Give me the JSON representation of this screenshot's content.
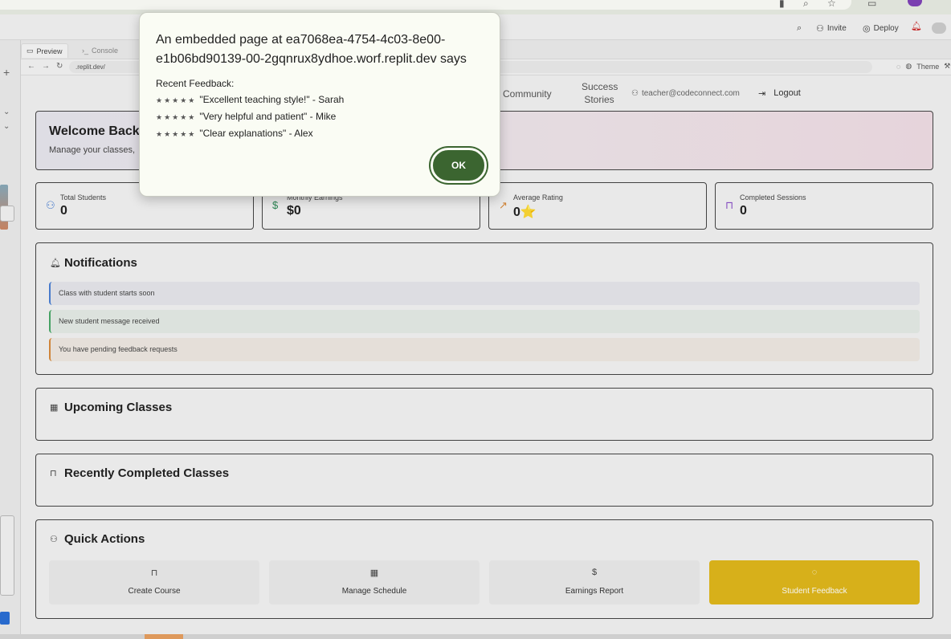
{
  "replit": {
    "header": {
      "invite_label": "Invite",
      "deploy_label": "Deploy"
    },
    "pane_tabs": [
      "Preview",
      "Console"
    ],
    "url": ".replit.dev/",
    "theme_label": "Theme"
  },
  "app": {
    "nav": {
      "community": "Community",
      "success_stories_line1": "Success",
      "success_stories_line2": "Stories",
      "user_email": "teacher@codeconnect.com",
      "logout": "Logout"
    },
    "welcome": {
      "title": "Welcome Back",
      "subtitle": "Manage your classes,"
    },
    "stats": [
      {
        "label": "Total Students",
        "value": "0",
        "icon": "users-icon"
      },
      {
        "label": "Monthly Earnings",
        "value": "$0",
        "icon": "dollar-icon"
      },
      {
        "label": "Average Rating",
        "value": "0⭐",
        "icon": "trending-up-icon"
      },
      {
        "label": "Completed Sessions",
        "value": "0",
        "icon": "book-icon"
      }
    ],
    "notifications": {
      "title": "Notifications",
      "items": [
        "Class with student starts soon",
        "New student message received",
        "You have pending feedback requests"
      ]
    },
    "upcoming": {
      "title": "Upcoming Classes"
    },
    "completed": {
      "title": "Recently Completed Classes"
    },
    "quick_actions": {
      "title": "Quick Actions",
      "items": [
        {
          "label": "Create Course",
          "icon": "book-icon"
        },
        {
          "label": "Manage Schedule",
          "icon": "calendar-icon"
        },
        {
          "label": "Earnings Report",
          "icon": "dollar-icon"
        },
        {
          "label": "Student Feedback",
          "icon": "message-icon"
        }
      ]
    }
  },
  "dialog": {
    "title": "An embedded page at ea7068ea-4754-4c03-8e00-e1b06bd90139-00-2gqnrux8ydhoe.worf.replit.dev says",
    "heading": "Recent Feedback:",
    "lines": [
      {
        "stars": "★★★★★",
        "text": "\"Excellent teaching style!\" - Sarah"
      },
      {
        "stars": "★★★★★",
        "text": "\"Very helpful and patient\" - Mike"
      },
      {
        "stars": "★★★★★",
        "text": "\"Clear explanations\" - Alex"
      }
    ],
    "ok_label": "OK"
  },
  "colors": {
    "ok_button": "#3b6530",
    "student_feedback_bg": "#e0b81c",
    "notif_blue": "#4a7fd4",
    "notif_green": "#48a868",
    "notif_orange": "#d88a3c"
  }
}
